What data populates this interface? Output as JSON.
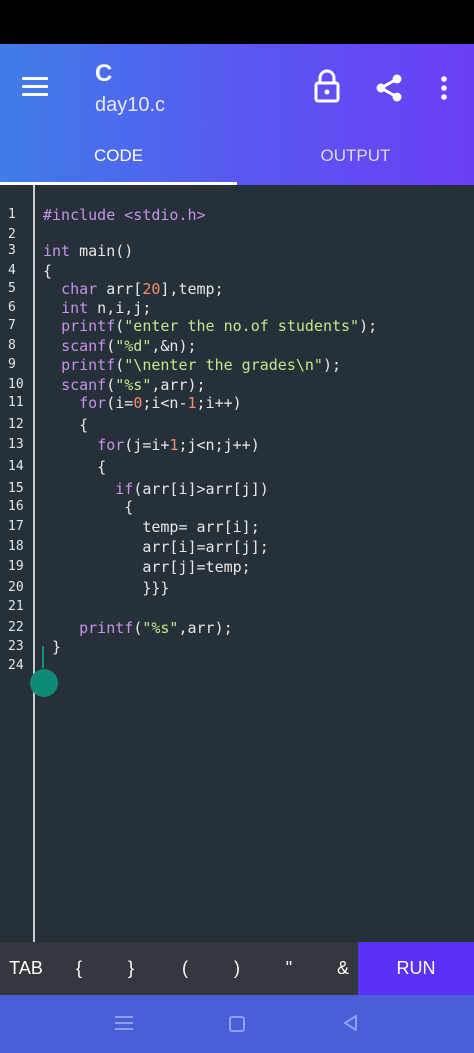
{
  "app": {
    "title": "C",
    "filename": "day10.c",
    "icons": {
      "menu": "hamburger-menu-icon",
      "lock": "lock-icon",
      "share": "share-icon",
      "more": "more-vert-icon"
    }
  },
  "tabs": [
    {
      "label": "CODE",
      "active": true
    },
    {
      "label": "OUTPUT",
      "active": false
    }
  ],
  "editor": {
    "line_numbers": [
      "1",
      "2",
      "3",
      "4",
      "5",
      "6",
      "7",
      "8",
      "9",
      "10",
      "11",
      "12",
      "13",
      "14",
      "15",
      "16",
      "17",
      "18",
      "19",
      "20",
      "21",
      "22",
      "23",
      "24"
    ]
  },
  "code_lines": [
    [
      {
        "t": "pre",
        "v": "#include <stdio.h>"
      }
    ],
    [],
    [
      {
        "t": "kw",
        "v": "int"
      },
      {
        "t": "p",
        "v": " main()"
      }
    ],
    [
      {
        "t": "p",
        "v": "{"
      }
    ],
    [
      {
        "t": "p",
        "v": "  "
      },
      {
        "t": "kw",
        "v": "char"
      },
      {
        "t": "p",
        "v": " arr["
      },
      {
        "t": "num",
        "v": "20"
      },
      {
        "t": "p",
        "v": "],temp;"
      }
    ],
    [
      {
        "t": "p",
        "v": "  "
      },
      {
        "t": "kw",
        "v": "int"
      },
      {
        "t": "p",
        "v": " n,i,j;"
      }
    ],
    [
      {
        "t": "p",
        "v": "  "
      },
      {
        "t": "kw",
        "v": "printf"
      },
      {
        "t": "p",
        "v": "("
      },
      {
        "t": "str",
        "v": "\"enter the no.of students\""
      },
      {
        "t": "p",
        "v": ");"
      }
    ],
    [
      {
        "t": "p",
        "v": "  "
      },
      {
        "t": "kw",
        "v": "scanf"
      },
      {
        "t": "p",
        "v": "("
      },
      {
        "t": "str",
        "v": "\"%d\""
      },
      {
        "t": "p",
        "v": ",&n);"
      }
    ],
    [
      {
        "t": "p",
        "v": "  "
      },
      {
        "t": "kw",
        "v": "printf"
      },
      {
        "t": "p",
        "v": "("
      },
      {
        "t": "str",
        "v": "\"\\nenter the grades\\n\""
      },
      {
        "t": "p",
        "v": ");"
      }
    ],
    [
      {
        "t": "p",
        "v": "  "
      },
      {
        "t": "kw",
        "v": "scanf"
      },
      {
        "t": "p",
        "v": "("
      },
      {
        "t": "str",
        "v": "\"%s\""
      },
      {
        "t": "p",
        "v": ",arr);"
      }
    ],
    [
      {
        "t": "p",
        "v": "    "
      },
      {
        "t": "kw",
        "v": "for"
      },
      {
        "t": "p",
        "v": "(i="
      },
      {
        "t": "num",
        "v": "0"
      },
      {
        "t": "p",
        "v": ";i<n-"
      },
      {
        "t": "num",
        "v": "1"
      },
      {
        "t": "p",
        "v": ";i++)"
      }
    ],
    [
      {
        "t": "p",
        "v": "    {"
      }
    ],
    [
      {
        "t": "p",
        "v": "      "
      },
      {
        "t": "kw",
        "v": "for"
      },
      {
        "t": "p",
        "v": "(j=i+"
      },
      {
        "t": "num",
        "v": "1"
      },
      {
        "t": "p",
        "v": ";j<n;j++)"
      }
    ],
    [
      {
        "t": "p",
        "v": "      {"
      }
    ],
    [
      {
        "t": "p",
        "v": "        "
      },
      {
        "t": "kw",
        "v": "if"
      },
      {
        "t": "p",
        "v": "(arr[i]>arr[j])"
      }
    ],
    [
      {
        "t": "p",
        "v": "         {"
      }
    ],
    [
      {
        "t": "p",
        "v": "           temp= arr[i];"
      }
    ],
    [
      {
        "t": "p",
        "v": "           arr[i]=arr[j];"
      }
    ],
    [
      {
        "t": "p",
        "v": "           arr[j]=temp;"
      }
    ],
    [
      {
        "t": "p",
        "v": "           }}}"
      }
    ],
    [],
    [
      {
        "t": "p",
        "v": "    "
      },
      {
        "t": "kw",
        "v": "printf"
      },
      {
        "t": "p",
        "v": "("
      },
      {
        "t": "str",
        "v": "\"%s\""
      },
      {
        "t": "p",
        "v": ",arr);"
      }
    ],
    [
      {
        "t": "p",
        "v": " }"
      }
    ],
    []
  ],
  "keybar": {
    "keys": [
      "TAB",
      "{",
      "}",
      "(",
      ")",
      "\"",
      "&"
    ],
    "run_label": "RUN"
  },
  "navbar": {
    "icons": [
      "recents-icon",
      "home-icon",
      "back-icon"
    ]
  },
  "colors": {
    "accent": "#5a32f5",
    "editor_bg": "#263038",
    "keyword": "#c792ea",
    "string": "#c3e88d",
    "number": "#f78c6c"
  }
}
